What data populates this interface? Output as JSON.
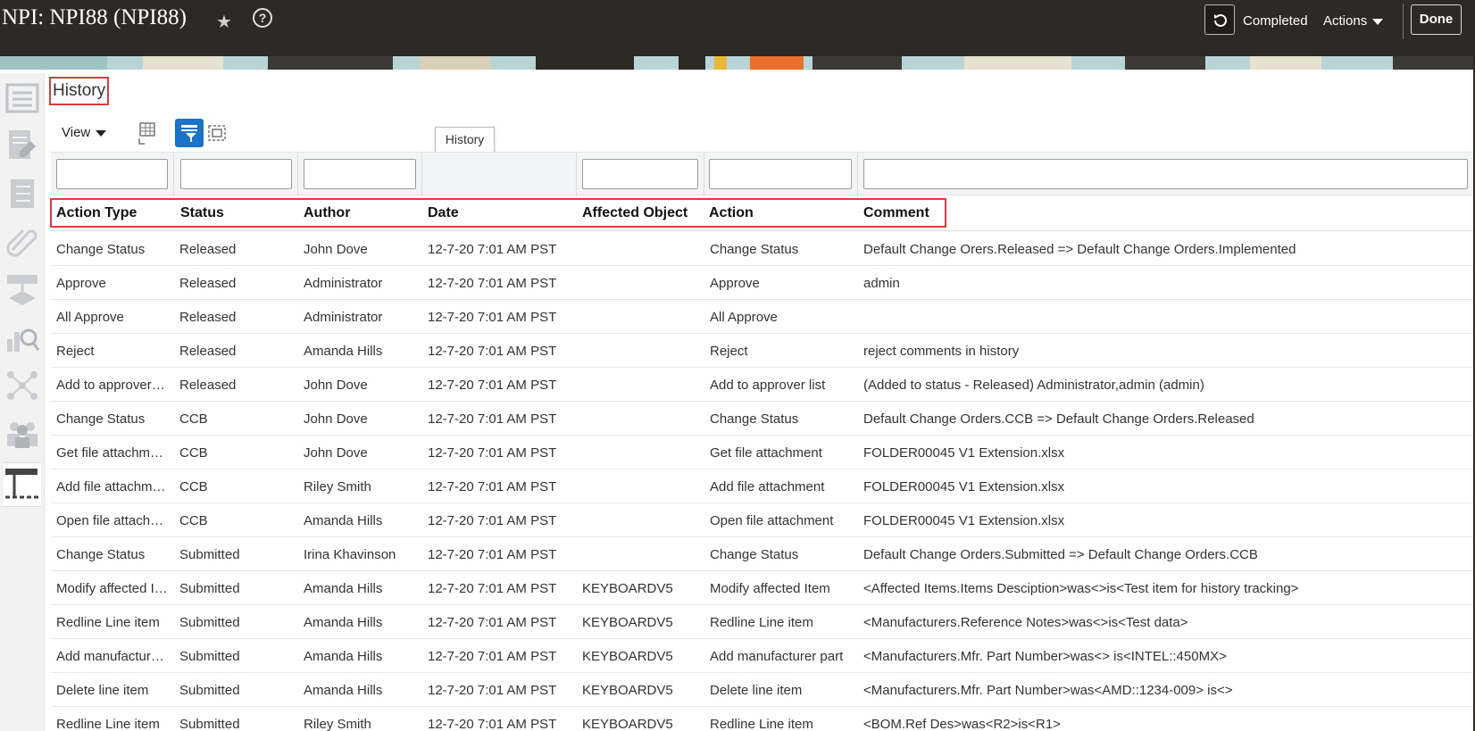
{
  "header": {
    "title": "NPI: NPI88 (NPI88)",
    "status": "Completed",
    "actions_label": "Actions",
    "done_label": "Done"
  },
  "section": {
    "title": "History"
  },
  "toolbar": {
    "view_label": "View",
    "tooltip": "History"
  },
  "columns": [
    "Action Type",
    "Status",
    "Author",
    "Date",
    "Affected Object",
    "Action",
    "Comment"
  ],
  "rows": [
    [
      "Change Status",
      "Released",
      "John Dove",
      "12-7-20 7:01 AM PST",
      "",
      "Change Status",
      "Default Change Orers.Released => Default Change Orders.Implemented"
    ],
    [
      "Approve",
      "Released",
      "Administrator",
      "12-7-20 7:01 AM PST",
      "",
      "Approve",
      "admin"
    ],
    [
      "All Approve",
      "Released",
      "Administrator",
      "12-7-20 7:01 AM PST",
      "",
      "All Approve",
      ""
    ],
    [
      "Reject",
      "Released",
      "Amanda Hills",
      "12-7-20 7:01 AM PST",
      "",
      "Reject",
      "reject comments in history"
    ],
    [
      "Add to approver…",
      "Released",
      "John Dove",
      "12-7-20 7:01 AM PST",
      "",
      "Add to approver list",
      "(Added to status - Released) Administrator,admin (admin)"
    ],
    [
      "Change Status",
      "CCB",
      "John Dove",
      "12-7-20 7:01 AM PST",
      "",
      "Change Status",
      "Default Change Orders.CCB => Default Change Orders.Released"
    ],
    [
      "Get file attachm…",
      "CCB",
      "John Dove",
      "12-7-20 7:01 AM PST",
      "",
      "Get file attachment",
      "FOLDER00045 V1 Extension.xlsx"
    ],
    [
      "Add file attachm…",
      "CCB",
      "Riley Smith",
      "12-7-20 7:01 AM PST",
      "",
      "Add file attachment",
      "FOLDER00045 V1 Extension.xlsx"
    ],
    [
      "Open file attach…",
      "CCB",
      "Amanda Hills",
      "12-7-20 7:01 AM PST",
      "",
      "Open file attachment",
      "FOLDER00045 V1 Extension.xlsx"
    ],
    [
      "Change Status",
      "Submitted",
      "Irina Khavinson",
      "12-7-20 7:01 AM PST",
      "",
      "Change Status",
      "Default Change Orders.Submitted => Default Change Orders.CCB"
    ],
    [
      "Modify affected I…",
      "Submitted",
      "Amanda Hills",
      "12-7-20 7:01 AM PST",
      "KEYBOARDV5",
      "Modify affected Item",
      "<Affected Items.Items Desciption>was<>is<Test item for history tracking>"
    ],
    [
      "Redline Line item",
      "Submitted",
      "Amanda Hills",
      "12-7-20 7:01 AM PST",
      "KEYBOARDV5",
      "Redline Line item",
      "<Manufacturers.Reference Notes>was<>is<Test data>"
    ],
    [
      "Add manufactur…",
      "Submitted",
      "Amanda Hills",
      "12-7-20 7:01 AM PST",
      "KEYBOARDV5",
      "Add manufacturer part",
      "<Manufacturers.Mfr. Part Number>was<> is<INTEL::450MX>"
    ],
    [
      "Delete line item",
      "Submitted",
      "Amanda Hills",
      "12-7-20 7:01 AM PST",
      "KEYBOARDV5",
      "Delete line item",
      "<Manufacturers.Mfr. Part Number>was<AMD::1234-009> is<>"
    ],
    [
      "Redline Line item",
      "Submitted",
      "Riley Smith",
      "12-7-20 7:01 AM PST",
      "KEYBOARDV5",
      "Redline Line item",
      "<BOM.Ref Des>was<R2>is<R1>"
    ]
  ],
  "icons": {
    "favorite": "star-icon",
    "help": "help-icon",
    "refresh": "refresh-icon",
    "rail": [
      "overview-icon",
      "edit-icon",
      "checklist-icon",
      "attachment-icon",
      "workflow-icon",
      "search-report-icon",
      "relationships-icon",
      "team-icon",
      "history-icon"
    ]
  },
  "colors": {
    "header_bg": "#2d2a26",
    "highlight": "#e03c3c",
    "active_button": "#1a73c8"
  }
}
